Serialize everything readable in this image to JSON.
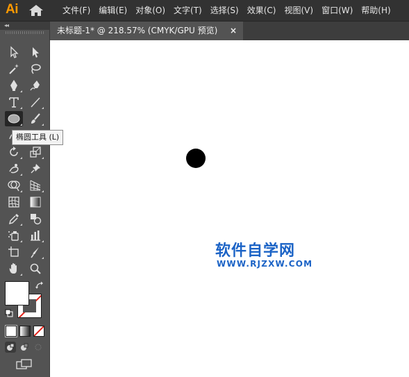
{
  "app": {
    "logo": "Ai"
  },
  "menu": [
    "文件(F)",
    "编辑(E)",
    "对象(O)",
    "文字(T)",
    "选择(S)",
    "效果(C)",
    "视图(V)",
    "窗口(W)",
    "帮助(H)"
  ],
  "document_tab": {
    "title": "未标题-1* @ 218.57% (CMYK/GPU 预览)",
    "close": "×"
  },
  "tooltip": {
    "text": "椭圆工具 (L)"
  },
  "toolbar": {
    "collapse": "◂◂",
    "tools": [
      "selection-tool",
      "direct-selection-tool",
      "magic-wand-tool",
      "lasso-tool",
      "pen-tool",
      "curvature-tool",
      "type-tool",
      "line-segment-tool",
      "ellipse-tool",
      "paintbrush-tool",
      "shaper-tool",
      "eraser-tool",
      "rotate-tool",
      "scale-tool",
      "puppet-warp-tool",
      "pin-tool",
      "shape-builder-tool",
      "perspective-grid-tool",
      "mesh-tool",
      "gradient-tool",
      "eyedropper-tool",
      "blend-tool",
      "symbol-sprayer-tool",
      "column-graph-tool",
      "artboard-tool",
      "slice-tool",
      "hand-tool",
      "zoom-tool"
    ],
    "active_tool": "ellipse-tool",
    "fill_color": "#ffffff",
    "stroke": "none"
  },
  "canvas": {
    "watermark": {
      "title": "软件自学网",
      "url": "WWW.RJZXW.COM"
    }
  },
  "colors": {
    "menubar": "#323232",
    "panel": "#535353",
    "canvas": "#ffffff",
    "logo": "#ff9a00",
    "watermark": "#1b63c6"
  }
}
